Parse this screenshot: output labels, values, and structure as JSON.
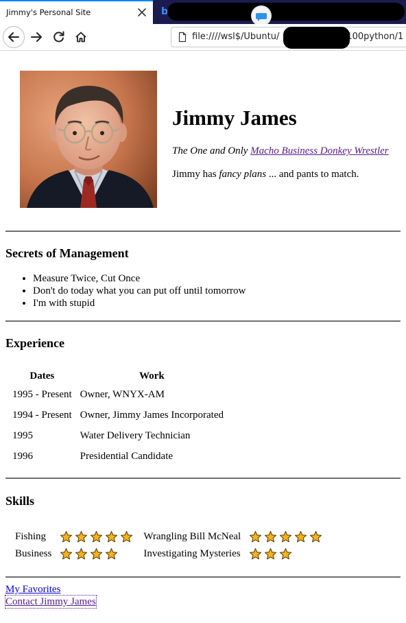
{
  "browser": {
    "tab_title": "Jimmy's Personal Site",
    "url": "file:////wsl$/Ubuntu/",
    "url_suffix": "100python/1"
  },
  "header": {
    "name": "Jimmy James",
    "tagline_prefix": "The One and Only ",
    "tagline_link": "Macho Business Donkey Wrestler",
    "bio_start": "Jimmy has ",
    "bio_em": "fancy plans",
    "bio_end": " ... and pants to match."
  },
  "secrets": {
    "heading": "Secrets of Management",
    "items": [
      "Measure Twice, Cut Once",
      "Don't do today what you can put off until tomorrow",
      "I'm with stupid"
    ]
  },
  "experience": {
    "heading": "Experience",
    "columns": [
      "Dates",
      "Work"
    ],
    "rows": [
      {
        "dates": "1995 - Present",
        "work": "Owner, WNYX-AM"
      },
      {
        "dates": "1994 - Present",
        "work": "Owner, Jimmy James Incorporated"
      },
      {
        "dates": "1995",
        "work": "Water Delivery Technician"
      },
      {
        "dates": "1996",
        "work": "Presidential Candidate"
      }
    ]
  },
  "skills": {
    "heading": "Skills",
    "items": [
      {
        "name": "Fishing",
        "stars": 5
      },
      {
        "name": "Wrangling Bill McNeal",
        "stars": 5
      },
      {
        "name": "Business",
        "stars": 4
      },
      {
        "name": "Investigating Mysteries",
        "stars": 3
      }
    ]
  },
  "footer": {
    "favorites_link": "My Favorites",
    "contact_link": "Contact Jimmy James"
  },
  "colors": {
    "accent_tab": "#0a84ff",
    "link": "#0000ee",
    "visited_link": "#551a8b",
    "star_fill": "#f5b21d"
  },
  "icons": {
    "tab_close": "close-icon",
    "back": "back-arrow-icon",
    "forward": "forward-arrow-icon",
    "reload": "reload-icon",
    "home": "home-icon",
    "page": "page-icon",
    "star": "star-icon"
  }
}
